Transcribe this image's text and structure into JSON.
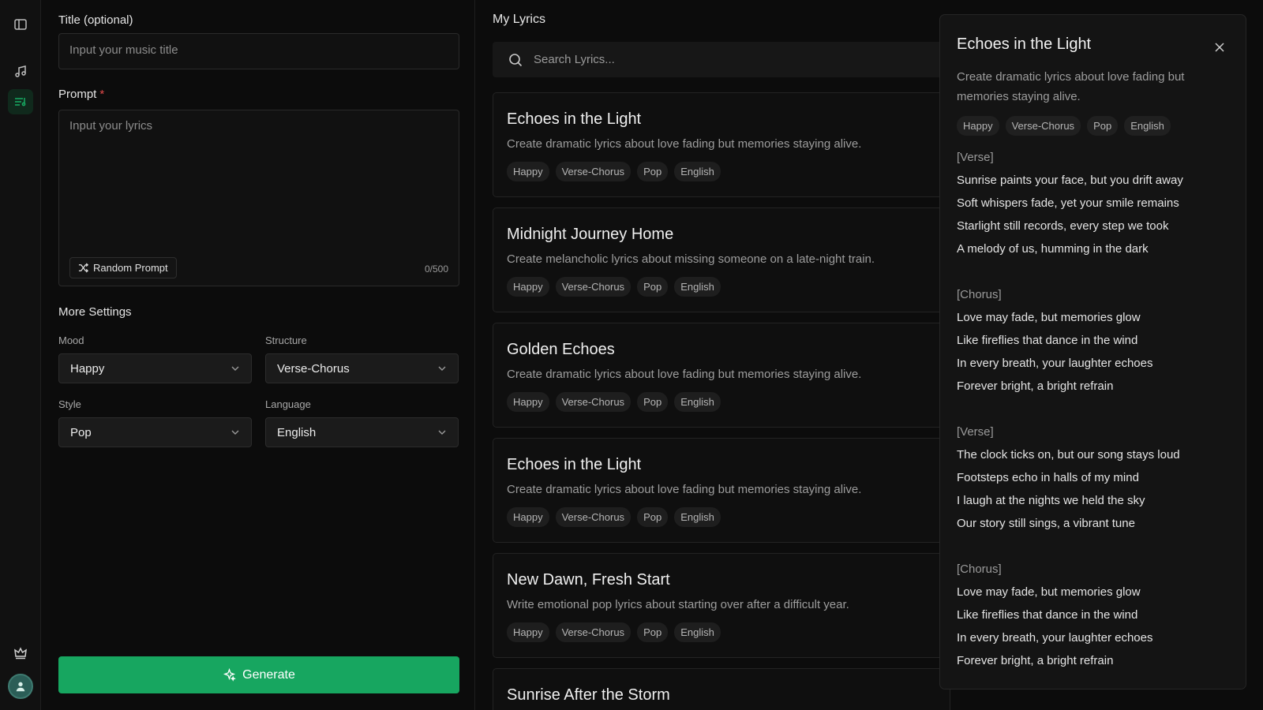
{
  "form": {
    "title_label": "Title (optional)",
    "title_placeholder": "Input your music title",
    "prompt_label": "Prompt",
    "prompt_required": "*",
    "prompt_placeholder": "Input your lyrics",
    "random_prompt_label": "Random Prompt",
    "counter": "0/500",
    "more_settings": "More Settings",
    "mood": {
      "label": "Mood",
      "value": "Happy"
    },
    "structure": {
      "label": "Structure",
      "value": "Verse-Chorus"
    },
    "style": {
      "label": "Style",
      "value": "Pop"
    },
    "language": {
      "label": "Language",
      "value": "English"
    },
    "generate_label": "Generate"
  },
  "list": {
    "title": "My Lyrics",
    "search_placeholder": "Search Lyrics...",
    "cards": [
      {
        "title": "Echoes in the Light",
        "desc": "Create dramatic lyrics about love fading but memories staying alive.",
        "tags": [
          "Happy",
          "Verse-Chorus",
          "Pop",
          "English"
        ]
      },
      {
        "title": "Midnight Journey Home",
        "desc": "Create melancholic lyrics about missing someone on a late-night train.",
        "tags": [
          "Happy",
          "Verse-Chorus",
          "Pop",
          "English"
        ]
      },
      {
        "title": "Golden Echoes",
        "desc": "Create dramatic lyrics about love fading but memories staying alive.",
        "tags": [
          "Happy",
          "Verse-Chorus",
          "Pop",
          "English"
        ]
      },
      {
        "title": "Echoes in the Light",
        "desc": "Create dramatic lyrics about love fading but memories staying alive.",
        "tags": [
          "Happy",
          "Verse-Chorus",
          "Pop",
          "English"
        ]
      },
      {
        "title": "New Dawn, Fresh Start",
        "desc": "Write emotional pop lyrics about starting over after a difficult year.",
        "tags": [
          "Happy",
          "Verse-Chorus",
          "Pop",
          "English"
        ]
      },
      {
        "title": "Sunrise After the Storm",
        "desc": "",
        "tags": []
      }
    ]
  },
  "detail": {
    "title": "Echoes in the Light",
    "desc": "Create dramatic lyrics about love fading but memories staying alive.",
    "tags": [
      "Happy",
      "Verse-Chorus",
      "Pop",
      "English"
    ],
    "lines": [
      {
        "text": "[Verse]",
        "tag": true
      },
      {
        "text": "Sunrise paints your face, but you drift away"
      },
      {
        "text": "Soft whispers fade, yet your smile remains"
      },
      {
        "text": "Starlight still records, every step we took"
      },
      {
        "text": "A melody of us, humming in the dark"
      },
      {
        "text": "",
        "gap": true
      },
      {
        "text": "[Chorus]",
        "tag": true
      },
      {
        "text": "Love may fade, but memories glow"
      },
      {
        "text": "Like fireflies that dance in the wind"
      },
      {
        "text": "In every breath, your laughter echoes"
      },
      {
        "text": "Forever bright, a bright refrain"
      },
      {
        "text": "",
        "gap": true
      },
      {
        "text": "[Verse]",
        "tag": true
      },
      {
        "text": "The clock ticks on, but our song stays loud"
      },
      {
        "text": "Footsteps echo in halls of my mind"
      },
      {
        "text": "I laugh at the nights we held the sky"
      },
      {
        "text": "Our story still sings, a vibrant tune"
      },
      {
        "text": "",
        "gap": true
      },
      {
        "text": "[Chorus]",
        "tag": true
      },
      {
        "text": "Love may fade, but memories glow"
      },
      {
        "text": "Like fireflies that dance in the wind"
      },
      {
        "text": "In every breath, your laughter echoes"
      },
      {
        "text": "Forever bright, a bright refrain"
      }
    ]
  },
  "colors": {
    "accent": "#17a660",
    "background": "#0c0c0c",
    "required": "#e24a4a"
  }
}
